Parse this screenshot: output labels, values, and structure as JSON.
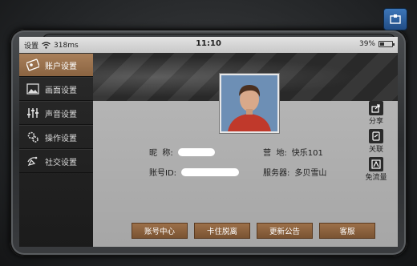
{
  "status_bar": {
    "carrier": "设置",
    "speed": "318ms",
    "time": "11:10",
    "battery": "39%",
    "battery_level": 0.39
  },
  "sidebar": {
    "items": [
      {
        "label": "账户设置",
        "icon": "account-card-icon",
        "active": true
      },
      {
        "label": "画面设置",
        "icon": "picture-icon",
        "active": false
      },
      {
        "label": "声音设置",
        "icon": "equalizer-icon",
        "active": false
      },
      {
        "label": "操作设置",
        "icon": "gears-icon",
        "active": false
      },
      {
        "label": "社交设置",
        "icon": "satellite-dish-icon",
        "active": false
      }
    ]
  },
  "profile": {
    "nickname_label": "昵  称:",
    "nickname_value": "",
    "camp_label": "营  地:",
    "camp_value": "快乐101",
    "account_label": "账号ID:",
    "account_value": "",
    "server_label": "服务器:",
    "server_value": "多贝雪山"
  },
  "actions": [
    {
      "label": "分享",
      "icon": "share-icon"
    },
    {
      "label": "关联",
      "icon": "link-icon"
    },
    {
      "label": "免流量",
      "icon": "data-free-icon"
    }
  ],
  "buttons": {
    "account_center": "账号中心",
    "unstuck": "卡住脱离",
    "announcement": "更新公告",
    "service": "客服"
  },
  "colors": {
    "accent": "#9c7049",
    "active_tab": "#a9805a",
    "corner_button": "#2f64a3"
  }
}
